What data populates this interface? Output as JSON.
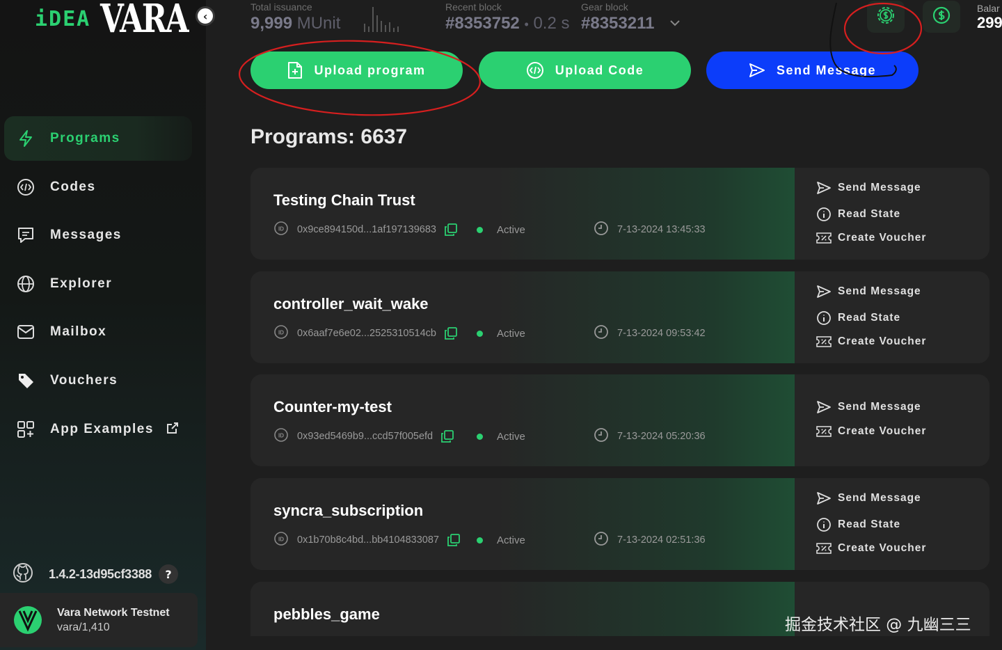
{
  "brand": {
    "idea": "iDEA",
    "vara": "VARA"
  },
  "header": {
    "issuance_label": "Total issuance",
    "issuance_value": "9,999",
    "issuance_unit": "MUnit",
    "recent_block_label": "Recent block",
    "recent_block_value": "#8353752",
    "recent_block_time": "0.2 s",
    "gear_block_label": "Gear block",
    "gear_block_value": "#8353211",
    "balance_label": "Balar",
    "balance_value": "299"
  },
  "actions": {
    "upload_program": "Upload program",
    "upload_code": "Upload Code",
    "send_message": "Send Message"
  },
  "nav": {
    "items": [
      {
        "label": "Programs",
        "icon": "lightning-icon",
        "active": true
      },
      {
        "label": "Codes",
        "icon": "code-icon"
      },
      {
        "label": "Messages",
        "icon": "message-icon"
      },
      {
        "label": "Explorer",
        "icon": "globe-icon"
      },
      {
        "label": "Mailbox",
        "icon": "mail-icon"
      },
      {
        "label": "Vouchers",
        "icon": "tag-icon"
      },
      {
        "label": "App Examples",
        "icon": "grid-plus-icon"
      }
    ]
  },
  "footer": {
    "version": "1.4.2-13d95cf3388",
    "help": "?",
    "network_name": "Vara Network Testnet",
    "network_sub": "vara/1,410"
  },
  "page": {
    "title": "Programs: 6637"
  },
  "programs": [
    {
      "name": "Testing Chain Trust",
      "id": "0x9ce894150d...1af197139683",
      "status": "Active",
      "time": "7-13-2024 13:45:33",
      "actions": [
        "Send Message",
        "Read State",
        "Create Voucher"
      ]
    },
    {
      "name": "controller_wait_wake",
      "id": "0x6aaf7e6e02...2525310514cb",
      "status": "Active",
      "time": "7-13-2024 09:53:42",
      "actions": [
        "Send Message",
        "Read State",
        "Create Voucher"
      ]
    },
    {
      "name": "Counter-my-test",
      "id": "0x93ed5469b9...ccd57f005efd",
      "status": "Active",
      "time": "7-13-2024 05:20:36",
      "actions": [
        "Send Message",
        "Create Voucher"
      ]
    },
    {
      "name": "syncra_subscription",
      "id": "0x1b70b8c4bd...bb4104833087",
      "status": "Active",
      "time": "7-13-2024 02:51:36",
      "actions": [
        "Send Message",
        "Read State",
        "Create Voucher"
      ]
    },
    {
      "name": "pebbles_game",
      "id": "",
      "status": "",
      "time": "",
      "actions": []
    }
  ],
  "watermark": "掘金技术社区 @ 九幽三三",
  "colors": {
    "accent_green": "#2bd071",
    "accent_blue": "#0c3dfa",
    "annotation_red": "#d61f1f"
  }
}
